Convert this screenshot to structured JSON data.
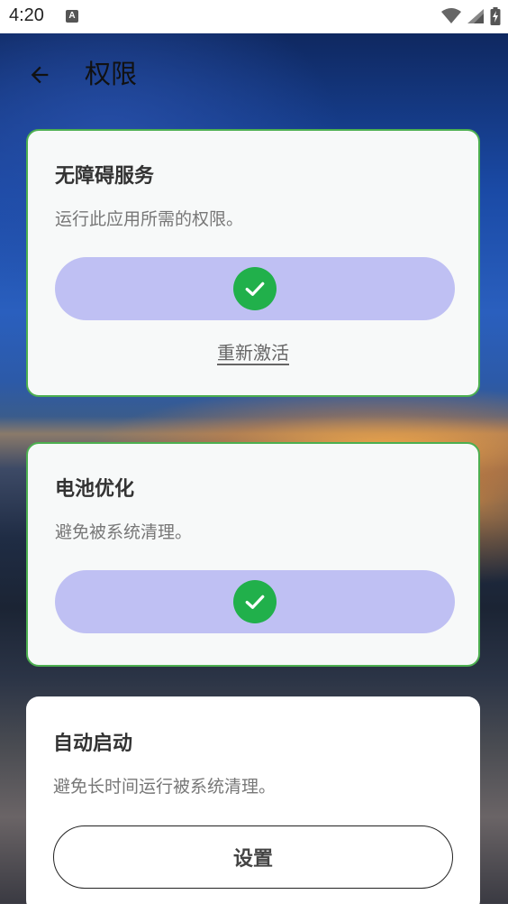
{
  "status_bar": {
    "time": "4:20",
    "notification_letter": "A"
  },
  "app_bar": {
    "title": "权限"
  },
  "cards": [
    {
      "title": "无障碍服务",
      "description": "运行此应用所需的权限。",
      "status": "granted",
      "link": "重新激活"
    },
    {
      "title": "电池优化",
      "description": "避免被系统清理。",
      "status": "granted"
    },
    {
      "title": "自动启动",
      "description": "避免长时间运行被系统清理。",
      "button_label": "设置"
    }
  ],
  "colors": {
    "pill_background": "#bfc0f3",
    "check_green": "#21b04b",
    "card_border_green": "#4caf50"
  }
}
